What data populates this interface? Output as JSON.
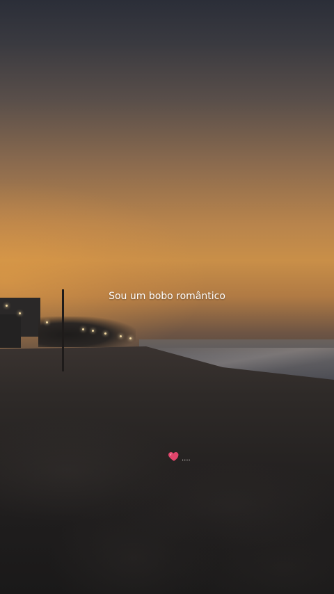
{
  "overlay": {
    "caption": "Sou um bobo romântico",
    "sticker_emoji": "heart-icon",
    "sticker_suffix": "....",
    "heart_color": "#e0456b"
  },
  "colors": {
    "sky_top": "#2b2e38",
    "horizon": "#c98f48",
    "sand": "#1f1d1d"
  }
}
